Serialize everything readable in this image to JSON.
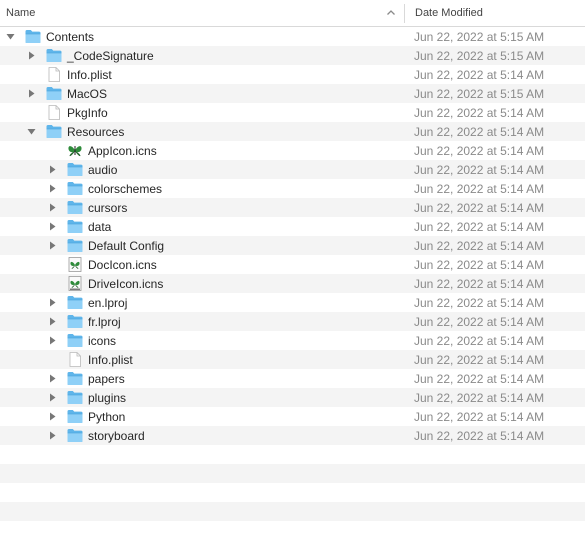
{
  "header": {
    "name_label": "Name",
    "date_label": "Date Modified",
    "sort_icon": "chevron-up-icon"
  },
  "colors": {
    "folder": "#5fb5ea",
    "folder_tab": "#8fd0f7",
    "stripe": "#f4f4f4",
    "date_text": "#8a8a8a"
  },
  "rows": [
    {
      "name": "Contents",
      "date": "Jun 22, 2022 at 5:15 AM",
      "level": 0,
      "kind": "folder",
      "disclosure": "open"
    },
    {
      "name": "_CodeSignature",
      "date": "Jun 22, 2022 at 5:15 AM",
      "level": 1,
      "kind": "folder",
      "disclosure": "closed"
    },
    {
      "name": "Info.plist",
      "date": "Jun 22, 2022 at 5:14 AM",
      "level": 1,
      "kind": "file",
      "disclosure": "none"
    },
    {
      "name": "MacOS",
      "date": "Jun 22, 2022 at 5:15 AM",
      "level": 1,
      "kind": "folder",
      "disclosure": "closed"
    },
    {
      "name": "PkgInfo",
      "date": "Jun 22, 2022 at 5:14 AM",
      "level": 1,
      "kind": "file",
      "disclosure": "none"
    },
    {
      "name": "Resources",
      "date": "Jun 22, 2022 at 5:14 AM",
      "level": 1,
      "kind": "folder",
      "disclosure": "open"
    },
    {
      "name": "AppIcon.icns",
      "date": "Jun 22, 2022 at 5:14 AM",
      "level": 2,
      "kind": "appicon",
      "disclosure": "none"
    },
    {
      "name": "audio",
      "date": "Jun 22, 2022 at 5:14 AM",
      "level": 2,
      "kind": "folder",
      "disclosure": "closed"
    },
    {
      "name": "colorschemes",
      "date": "Jun 22, 2022 at 5:14 AM",
      "level": 2,
      "kind": "folder",
      "disclosure": "closed"
    },
    {
      "name": "cursors",
      "date": "Jun 22, 2022 at 5:14 AM",
      "level": 2,
      "kind": "folder",
      "disclosure": "closed"
    },
    {
      "name": "data",
      "date": "Jun 22, 2022 at 5:14 AM",
      "level": 2,
      "kind": "folder",
      "disclosure": "closed"
    },
    {
      "name": "Default Config",
      "date": "Jun 22, 2022 at 5:14 AM",
      "level": 2,
      "kind": "folder",
      "disclosure": "closed"
    },
    {
      "name": "DocIcon.icns",
      "date": "Jun 22, 2022 at 5:14 AM",
      "level": 2,
      "kind": "docicon",
      "disclosure": "none"
    },
    {
      "name": "DriveIcon.icns",
      "date": "Jun 22, 2022 at 5:14 AM",
      "level": 2,
      "kind": "driveicon",
      "disclosure": "none"
    },
    {
      "name": "en.lproj",
      "date": "Jun 22, 2022 at 5:14 AM",
      "level": 2,
      "kind": "folder",
      "disclosure": "closed"
    },
    {
      "name": "fr.lproj",
      "date": "Jun 22, 2022 at 5:14 AM",
      "level": 2,
      "kind": "folder",
      "disclosure": "closed"
    },
    {
      "name": "icons",
      "date": "Jun 22, 2022 at 5:14 AM",
      "level": 2,
      "kind": "folder",
      "disclosure": "closed"
    },
    {
      "name": "Info.plist",
      "date": "Jun 22, 2022 at 5:14 AM",
      "level": 2,
      "kind": "file",
      "disclosure": "none"
    },
    {
      "name": "papers",
      "date": "Jun 22, 2022 at 5:14 AM",
      "level": 2,
      "kind": "folder",
      "disclosure": "closed"
    },
    {
      "name": "plugins",
      "date": "Jun 22, 2022 at 5:14 AM",
      "level": 2,
      "kind": "folder",
      "disclosure": "closed"
    },
    {
      "name": "Python",
      "date": "Jun 22, 2022 at 5:14 AM",
      "level": 2,
      "kind": "folder",
      "disclosure": "closed"
    },
    {
      "name": "storyboard",
      "date": "Jun 22, 2022 at 5:14 AM",
      "level": 2,
      "kind": "folder",
      "disclosure": "closed"
    }
  ]
}
